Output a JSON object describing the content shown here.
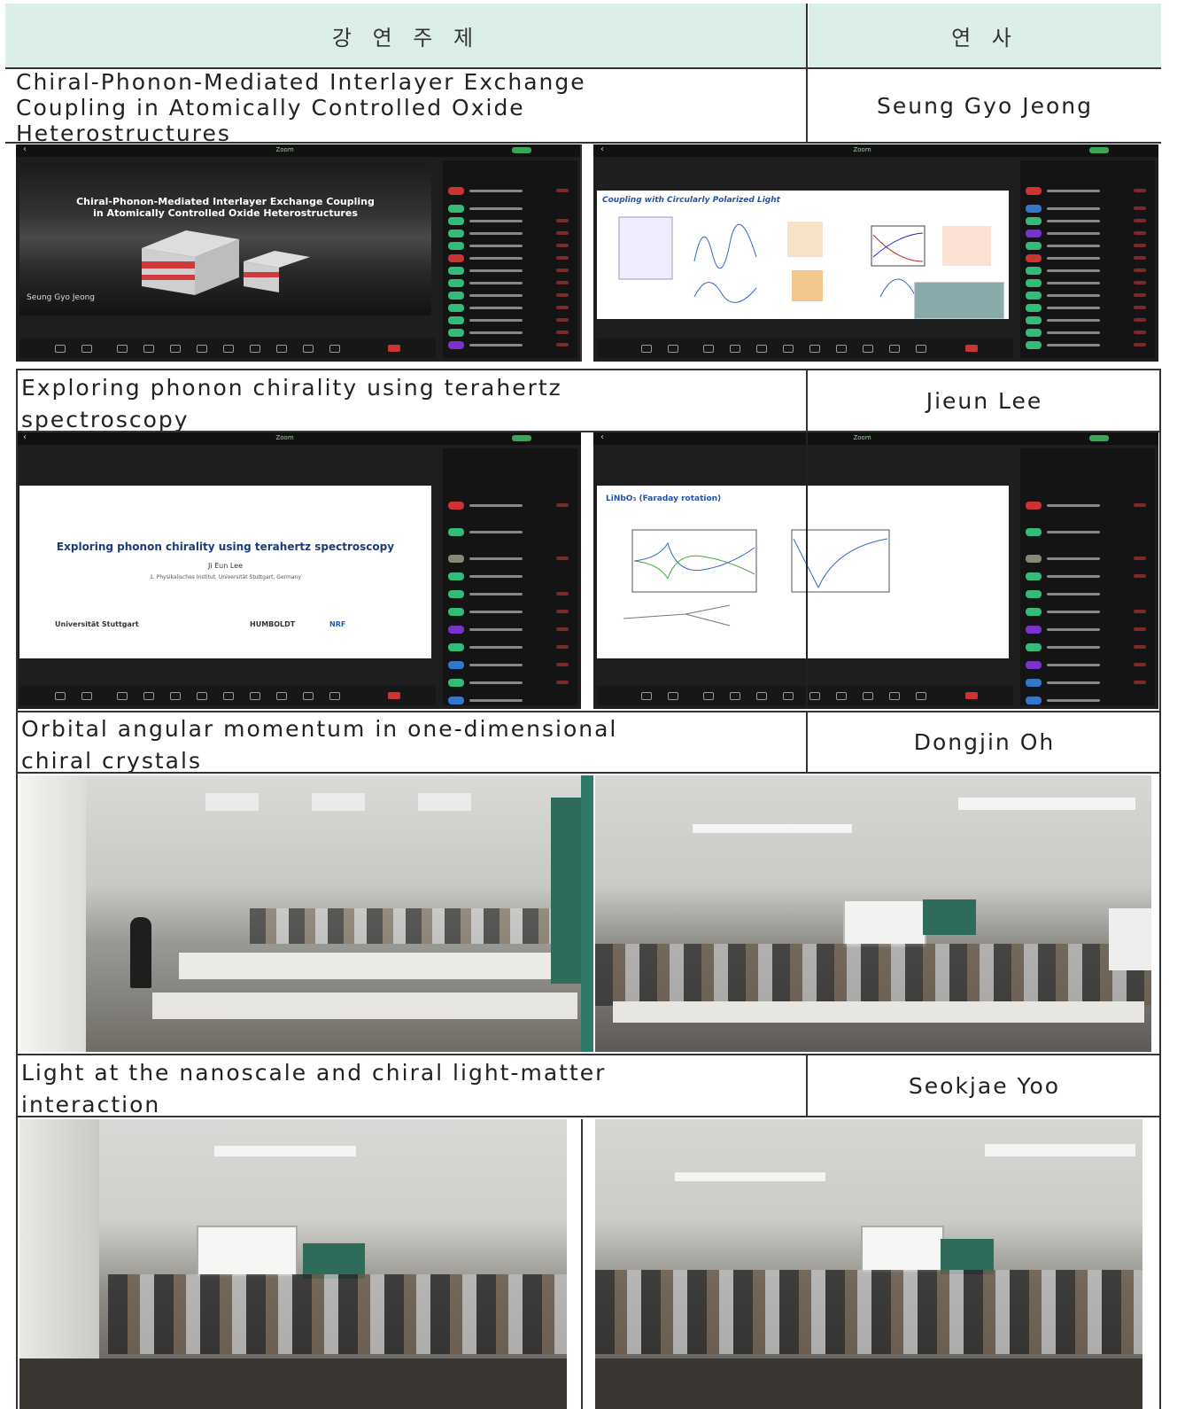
{
  "table": {
    "header": {
      "topic": "강 연 주 제",
      "speaker": "연 사"
    },
    "rows": [
      {
        "topic_lines": [
          "Chiral-Phonon-Mediated Interlayer Exchange",
          "Coupling in Atomically Controlled Oxide",
          "Heterostructures"
        ],
        "speaker": "Seung Gyo Jeong"
      },
      {
        "topic_lines": [
          "Exploring phonon chirality using terahertz",
          "spectroscopy"
        ],
        "speaker": "Jieun Lee"
      },
      {
        "topic_lines": [
          "Orbital angular momentum in one-dimensional",
          "chiral crystals"
        ],
        "speaker": "Dongjin Oh"
      },
      {
        "topic_lines": [
          "Light at the nanoscale and chiral light-matter",
          "interaction"
        ],
        "speaker": "Seokjae Yoo"
      }
    ]
  },
  "screens": {
    "s1": {
      "title_l1": "Chiral-Phonon-Mediated Interlayer Exchange Coupling",
      "title_l2": "in Atomically Controlled Oxide Heterostructures",
      "speaker": "Seung Gyo Jeong"
    },
    "s2": {
      "heading": "Coupling with Circularly Polarized Light"
    },
    "s3": {
      "title": "Exploring phonon chirality using terahertz spectroscopy",
      "name": "Ji Eun Lee",
      "affiliation": "1. Physikalisches Institut, Universität Stuttgart, Germany",
      "logo_left": "Universität Stuttgart",
      "logo_mid": "HUMBOLDT",
      "logo_right": "NRF"
    },
    "s4": {
      "heading": "LiNbO₃ (Faraday rotation)"
    },
    "zoom_label": "Zoom"
  },
  "colors": {
    "header_bg": "#dcefe6",
    "border": "#333333",
    "zoom_bg": "#1e1e1e"
  }
}
